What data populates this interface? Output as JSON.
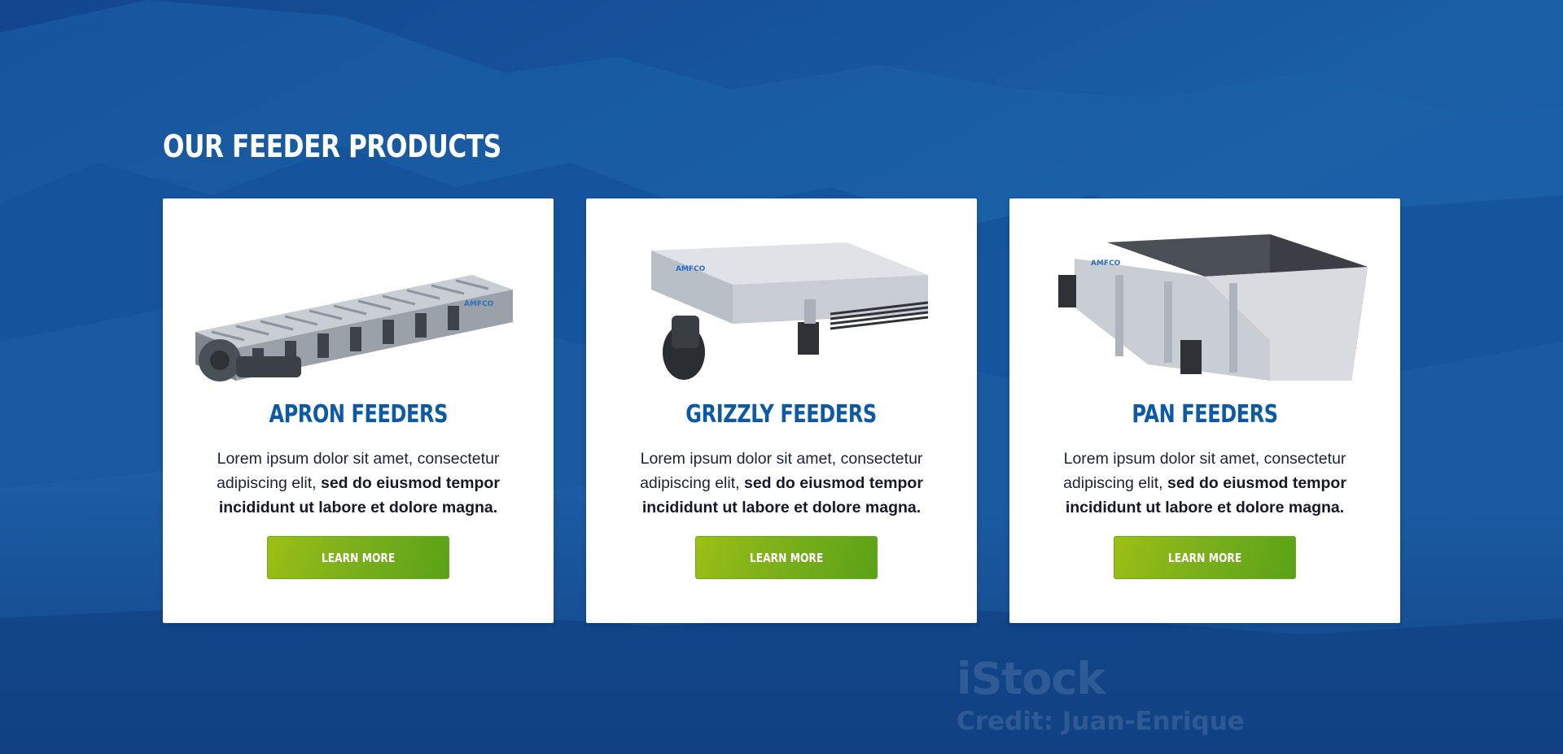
{
  "section": {
    "title": "OUR FEEDER PRODUCTS"
  },
  "products": [
    {
      "title": "APRON FEEDERS",
      "description_plain": "Lorem ipsum dolor sit amet, consectetur adipiscing elit, ",
      "description_bold": "sed do eiusmod tempor incididunt ut labore et dolore magna.",
      "button_label": "LEARN MORE",
      "image_icon": "apron-feeder-icon"
    },
    {
      "title": "GRIZZLY FEEDERS",
      "description_plain": "Lorem ipsum dolor sit amet, consectetur adipiscing elit, ",
      "description_bold": "sed do eiusmod tempor incididunt ut labore et dolore magna.",
      "button_label": "LEARN MORE",
      "image_icon": "grizzly-feeder-icon"
    },
    {
      "title": "PAN FEEDERS",
      "description_plain": "Lorem ipsum dolor sit amet, consectetur adipiscing elit, ",
      "description_bold": "sed do eiusmod tempor incididunt ut labore et dolore magna.",
      "button_label": "LEARN MORE",
      "image_icon": "pan-feeder-icon"
    }
  ],
  "watermark": {
    "brand": "iStock",
    "credit": "Credit: Juan-Enrique"
  },
  "colors": {
    "title_blue": "#0a5aa8",
    "button_green": "#7cb01a",
    "background_blue": "#0d4d96"
  }
}
